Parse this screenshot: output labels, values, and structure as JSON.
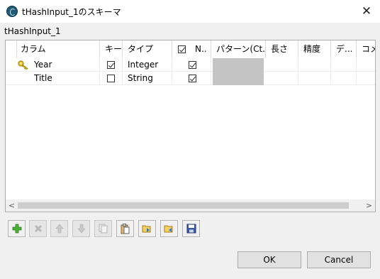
{
  "window": {
    "title": "tHashInput_1のスキーマ",
    "close_glyph": "✕",
    "icon": "talend-app-icon"
  },
  "section_label": "tHashInput_1",
  "table": {
    "columns": [
      "カラム",
      "キー",
      "タイプ",
      "",
      "N..",
      "パターン(Ct...",
      "長さ",
      "精度",
      "デ...",
      "コメント"
    ],
    "rows": [
      {
        "name": "Year",
        "key": true,
        "type": "Integer",
        "nullable": true,
        "is_key_icon": true
      },
      {
        "name": "Title",
        "key": false,
        "type": "String",
        "nullable": true,
        "is_key_icon": false
      }
    ],
    "header_nullable_checked": true,
    "colors": {
      "pattern_cell": "#c4c4c4",
      "key_icon": "#e8c21e"
    }
  },
  "scrollbar": {
    "left_glyph": "<",
    "right_glyph": ">"
  },
  "toolbar": {
    "buttons": [
      {
        "icon": "add-icon",
        "enabled": true
      },
      {
        "icon": "remove-icon",
        "enabled": false
      },
      {
        "icon": "move-up-icon",
        "enabled": false
      },
      {
        "icon": "move-down-icon",
        "enabled": false
      },
      {
        "icon": "copy-icon",
        "enabled": false
      },
      {
        "icon": "paste-icon",
        "enabled": true
      },
      {
        "icon": "import-icon",
        "enabled": true
      },
      {
        "icon": "export-icon",
        "enabled": true
      },
      {
        "icon": "save-icon",
        "enabled": true
      }
    ]
  },
  "buttons": {
    "ok": "OK",
    "cancel": "Cancel"
  }
}
